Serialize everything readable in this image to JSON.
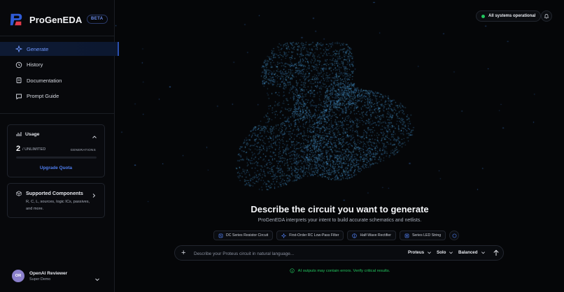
{
  "brand": {
    "name": "ProGenEDA",
    "badge": "BETA"
  },
  "nav": [
    {
      "label": "Generate",
      "icon": "sparkle-icon",
      "active": true
    },
    {
      "label": "History",
      "icon": "clock-icon",
      "active": false
    },
    {
      "label": "Documentation",
      "icon": "book-icon",
      "active": false
    },
    {
      "label": "Prompt Guide",
      "icon": "chat-icon",
      "active": false
    }
  ],
  "usage": {
    "title": "Usage",
    "count": "2",
    "unit": "/ UNLIMITED",
    "generations_label": "GENERATIONS",
    "progress": 0,
    "upgrade_label": "Upgrade Quota"
  },
  "components": {
    "title": "Supported Components",
    "description": "R, C, L, sources, logic ICs, passives, and more."
  },
  "user": {
    "initials": "OR",
    "name": "OpenAI Reviewer",
    "role": "Super Demo"
  },
  "status": {
    "label": "All systems operational",
    "color": "#22c55e"
  },
  "hero": {
    "title": "Describe the circuit you want to generate",
    "subtitle": "ProGenEDA interprets your intent to build accurate schematics and netlists."
  },
  "chips": [
    {
      "label": "DC Series Resistor Circuit",
      "icon": "resistor-icon"
    },
    {
      "label": "First-Order RC Low-Pass Filter",
      "icon": "filter-icon"
    },
    {
      "label": "Half-Wave Rectifier",
      "icon": "rectifier-icon"
    },
    {
      "label": "Series LED String",
      "icon": "led-icon"
    }
  ],
  "prompt": {
    "placeholder": "Describe your Proteus circuit in natural language...",
    "tool": "Proteus",
    "mode": "Solo",
    "quality": "Balanced"
  },
  "disclaimer": "AI outputs may contain errors. Verify critical results.",
  "colors": {
    "accent": "#4f7ef0",
    "background": "#050608",
    "success": "#22c55e"
  }
}
